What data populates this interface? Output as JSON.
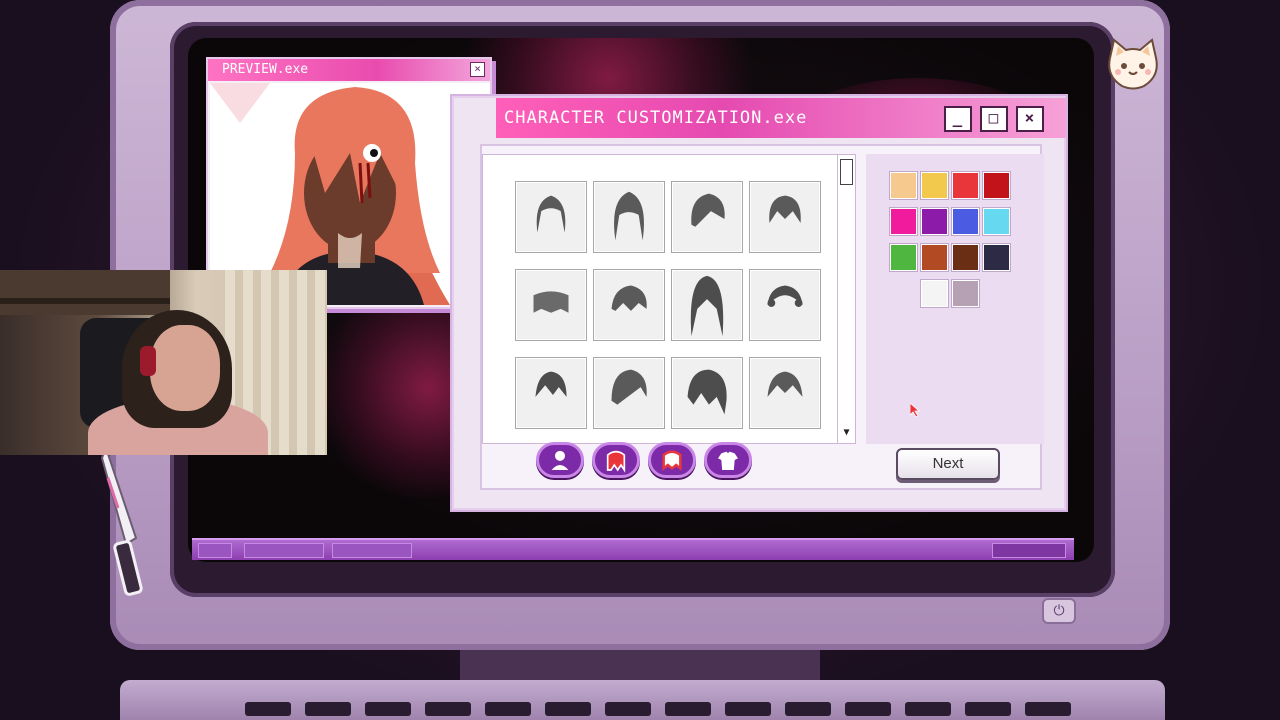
{
  "preview_window": {
    "title": "PREVIEW.exe",
    "close_label": "×"
  },
  "customization_window": {
    "title": "CHARACTER CUSTOMIZATION.exe",
    "minimize_label": "_",
    "maximize_label": "□",
    "close_label": "×",
    "hair_styles": [
      "hair-style-1",
      "hair-style-2",
      "hair-style-3",
      "hair-style-4",
      "hair-style-5",
      "hair-style-6",
      "hair-style-7",
      "hair-style-8",
      "hair-style-9",
      "hair-style-10",
      "hair-style-11",
      "hair-style-12"
    ],
    "color_swatches": [
      "#f6c98f",
      "#f2c94c",
      "#e8363a",
      "#c2121a",
      "#f01c9d",
      "#8b1ba8",
      "#4b5be2",
      "#66d8f0",
      "#4fb640",
      "#b24a24",
      "#6a2e14",
      "#2d2a45",
      "#f4f4f4",
      "#b5a0b4"
    ],
    "categories": [
      "body-category",
      "hair-front-category",
      "hair-back-category",
      "outfit-category"
    ],
    "next_label": "Next"
  },
  "colors": {
    "accent_pink": "#e94cae",
    "taskbar_purple": "#8c3fb0",
    "category_purple": "#7d2aa8"
  }
}
